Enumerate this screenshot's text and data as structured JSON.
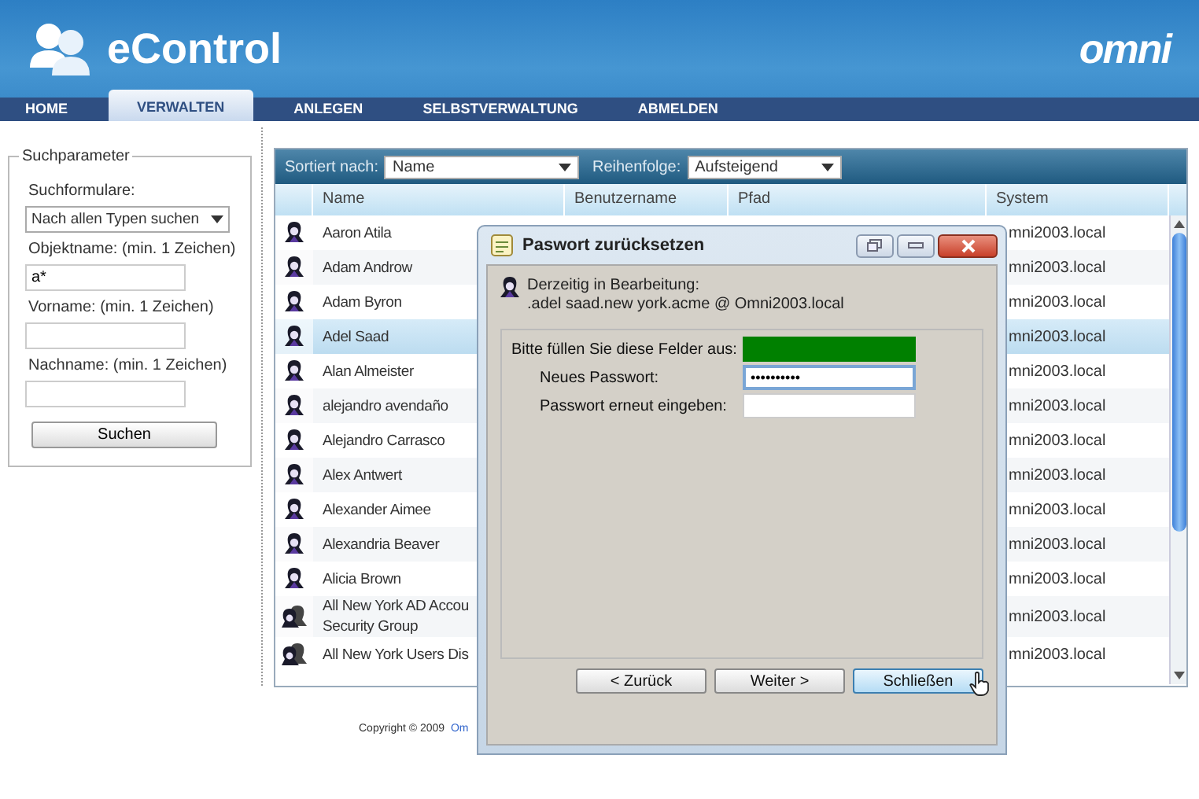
{
  "header": {
    "app_name": "eControl",
    "brand": "omni"
  },
  "nav": [
    {
      "label": "HOME",
      "selected": false
    },
    {
      "label": "VERWALTEN",
      "selected": true
    },
    {
      "label": "ANLEGEN",
      "selected": false
    },
    {
      "label": "SELBSTVERWALTUNG",
      "selected": false
    },
    {
      "label": "ABMELDEN",
      "selected": false
    }
  ],
  "search": {
    "legend": "Suchparameter",
    "form_label": "Suchformulare:",
    "form_value": "Nach allen Typen suchen",
    "fields": [
      {
        "label": "Objektname: (min. 1 Zeichen)",
        "value": "a*"
      },
      {
        "label": "Vorname: (min. 1 Zeichen)"
      },
      {
        "label": "Nachname: (min. 1 Zeichen)"
      }
    ],
    "button": "Suchen"
  },
  "table": {
    "sort_label": "Sortiert nach:",
    "sort_value": "Name",
    "order_label": "Reihenfolge:",
    "order_value": "Aufsteigend",
    "columns": [
      "Name",
      "Benutzername",
      "Pfad",
      "System"
    ],
    "rows": [
      {
        "kind": "user",
        "name": "Aaron Atila",
        "system": "mni2003.local",
        "selected": false
      },
      {
        "kind": "user",
        "name": "Adam Androw",
        "system": "mni2003.local",
        "selected": false
      },
      {
        "kind": "user",
        "name": "Adam Byron",
        "system": "mni2003.local",
        "selected": false
      },
      {
        "kind": "user",
        "name": "Adel Saad",
        "system": "mni2003.local",
        "selected": true
      },
      {
        "kind": "user",
        "name": "Alan Almeister",
        "system": "mni2003.local",
        "selected": false
      },
      {
        "kind": "user",
        "name": "alejandro avendaño",
        "system": "mni2003.local",
        "selected": false
      },
      {
        "kind": "user",
        "name": "Alejandro Carrasco",
        "system": "mni2003.local",
        "selected": false
      },
      {
        "kind": "user",
        "name": "Alex Antwert",
        "system": "mni2003.local",
        "selected": false
      },
      {
        "kind": "user",
        "name": "Alexander Aimee",
        "system": "mni2003.local",
        "selected": false
      },
      {
        "kind": "user",
        "name": "Alexandria Beaver",
        "system": "mni2003.local",
        "selected": false
      },
      {
        "kind": "user",
        "name": "Alicia Brown",
        "system": "mni2003.local",
        "selected": false
      },
      {
        "kind": "group",
        "name": "All New York AD Accou\nSecurity Group",
        "system": "mni2003.local",
        "selected": false
      },
      {
        "kind": "group",
        "name": "All New York Users Dis",
        "system": "mni2003.local",
        "selected": false
      }
    ]
  },
  "footer": {
    "text": "Copyright © 2009",
    "link": "Om"
  },
  "dialog": {
    "title": "Paswort zurücksetzen",
    "editing_label": "Derzeitig in Bearbeitung:",
    "editing_object": ".adel saad.new york.acme @ Omni2003.local",
    "instruction": "Bitte füllen Sie diese Felder aus:",
    "fields": [
      {
        "label": "Neues Passwort:",
        "value": "••••••••••",
        "focused": true
      },
      {
        "label": "Passwort erneut eingeben:",
        "focused": false
      }
    ],
    "buttons": [
      {
        "label": "< Zurück",
        "selected": false
      },
      {
        "label": "Weiter >",
        "selected": false
      },
      {
        "label": "Schließen",
        "selected": true
      }
    ]
  }
}
